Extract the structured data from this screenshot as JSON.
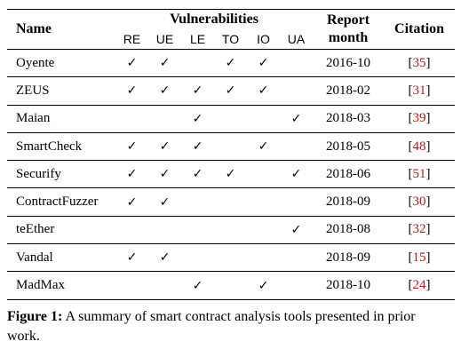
{
  "headers": {
    "name": "Name",
    "vulnerabilities": "Vulnerabilities",
    "vuln_columns": [
      "RE",
      "UE",
      "LE",
      "TO",
      "IO",
      "UA"
    ],
    "report_line1": "Report",
    "report_line2": "month",
    "citation": "Citation"
  },
  "check_mark": "✓",
  "rows": [
    {
      "name": "Oyente",
      "checks": [
        true,
        true,
        false,
        true,
        true,
        false
      ],
      "month": "2016-10",
      "cite_open": "[",
      "cite_num": "35",
      "cite_close": "]"
    },
    {
      "name": "ZEUS",
      "checks": [
        true,
        true,
        true,
        true,
        true,
        false
      ],
      "month": "2018-02",
      "cite_open": "[",
      "cite_num": "31",
      "cite_close": "]"
    },
    {
      "name": "Maian",
      "checks": [
        false,
        false,
        true,
        false,
        false,
        true
      ],
      "month": "2018-03",
      "cite_open": "[",
      "cite_num": "39",
      "cite_close": "]"
    },
    {
      "name": "SmartCheck",
      "checks": [
        true,
        true,
        true,
        false,
        true,
        false
      ],
      "month": "2018-05",
      "cite_open": "[",
      "cite_num": "48",
      "cite_close": "]"
    },
    {
      "name": "Securify",
      "checks": [
        true,
        true,
        true,
        true,
        false,
        true
      ],
      "month": "2018-06",
      "cite_open": "[",
      "cite_num": "51",
      "cite_close": "]"
    },
    {
      "name": "ContractFuzzer",
      "checks": [
        true,
        true,
        false,
        false,
        false,
        false
      ],
      "month": "2018-09",
      "cite_open": "[",
      "cite_num": "30",
      "cite_close": "]"
    },
    {
      "name": "teEther",
      "checks": [
        false,
        false,
        false,
        false,
        false,
        true
      ],
      "month": "2018-08",
      "cite_open": "[",
      "cite_num": "32",
      "cite_close": "]"
    },
    {
      "name": "Vandal",
      "checks": [
        true,
        true,
        false,
        false,
        false,
        false
      ],
      "month": "2018-09",
      "cite_open": "[",
      "cite_num": "15",
      "cite_close": "]"
    },
    {
      "name": "MadMax",
      "checks": [
        false,
        false,
        true,
        false,
        true,
        false
      ],
      "month": "2018-10",
      "cite_open": "[",
      "cite_num": "24",
      "cite_close": "]"
    }
  ],
  "caption": {
    "label": "Figure 1:",
    "text": " A summary of smart contract analysis tools presented in prior work."
  }
}
